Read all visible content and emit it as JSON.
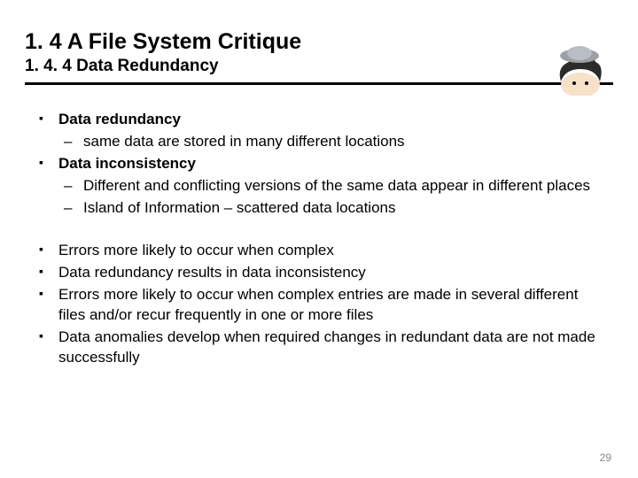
{
  "header": {
    "title": "1. 4 A File System Critique",
    "subtitle": "1. 4. 4 Data Redundancy"
  },
  "group1": [
    {
      "type": "l1",
      "bold": true,
      "text": "Data redundancy"
    },
    {
      "type": "l2",
      "bold": false,
      "text": "same data are stored in many different locations"
    },
    {
      "type": "l1",
      "bold": true,
      "text": "Data inconsistency"
    },
    {
      "type": "l2",
      "bold": false,
      "text": "Different and conflicting versions of the same data appear in different places"
    },
    {
      "type": "l2",
      "bold": false,
      "text": "Island of Information – scattered data locations"
    }
  ],
  "group2": [
    {
      "type": "l1",
      "bold": false,
      "text": "Errors more likely to occur when complex"
    },
    {
      "type": "l1",
      "bold": false,
      "text": "Data redundancy results in data inconsistency"
    },
    {
      "type": "l1",
      "bold": false,
      "text": "Errors more likely to occur when complex entries are made in several different files and/or recur frequently  in one or more files"
    },
    {
      "type": "l1",
      "bold": false,
      "text": "Data anomalies develop when required changes in redundant data are not made successfully"
    }
  ],
  "page_number": "29"
}
